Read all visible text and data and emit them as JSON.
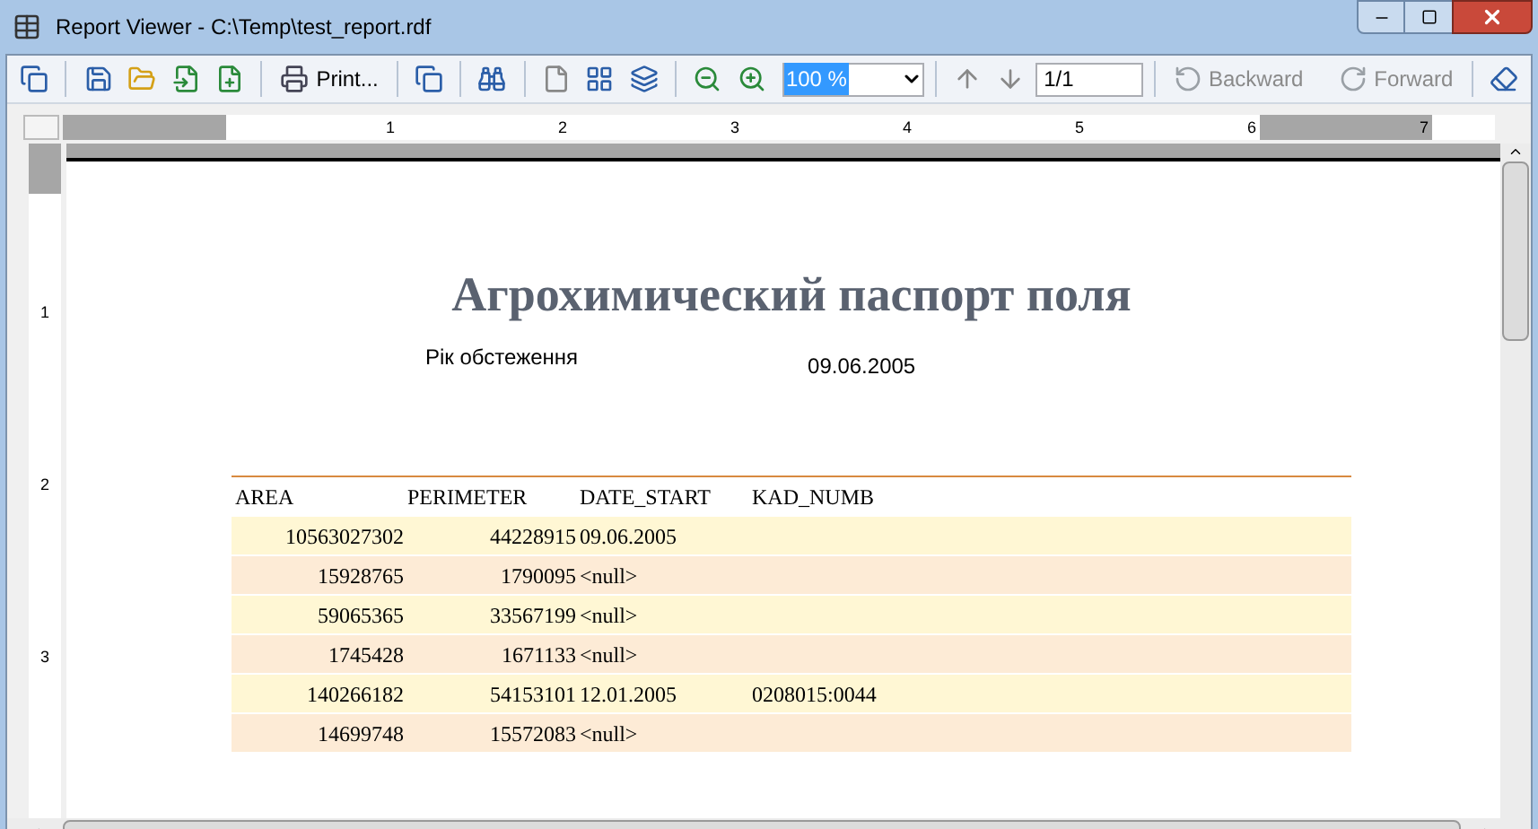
{
  "window": {
    "title": "Report Viewer - C:\\Temp\\test_report.rdf"
  },
  "toolbar": {
    "print_label": "Print...",
    "zoom_value": "100 %",
    "page_value": "1/1",
    "backward": {
      "label": "Backward",
      "disabled": true
    },
    "forward": {
      "label": "Forward",
      "disabled": true
    }
  },
  "ruler": {
    "h_marks": [
      "1",
      "2",
      "3",
      "4",
      "5",
      "6",
      "7"
    ],
    "v_marks": [
      "1",
      "2",
      "3"
    ]
  },
  "report": {
    "title": "Агрохимический паспорт поля",
    "subtitle_label": "Рік обстеження",
    "subtitle_value": "09.06.2005",
    "table": {
      "columns": [
        "AREA",
        "PERIMETER",
        "DATE_START",
        "KAD_NUMB"
      ],
      "rows": [
        [
          "10563027302",
          "44228915",
          "09.06.2005",
          ""
        ],
        [
          "15928765",
          "1790095",
          "<null>",
          ""
        ],
        [
          "59065365",
          "33567199",
          "<null>",
          ""
        ],
        [
          "1745428",
          "1671133",
          "<null>",
          ""
        ],
        [
          "140266182",
          "54153101",
          "12.01.2005",
          "0208015:0044"
        ],
        [
          "14699748",
          "15572083",
          "<null>",
          ""
        ]
      ]
    }
  }
}
